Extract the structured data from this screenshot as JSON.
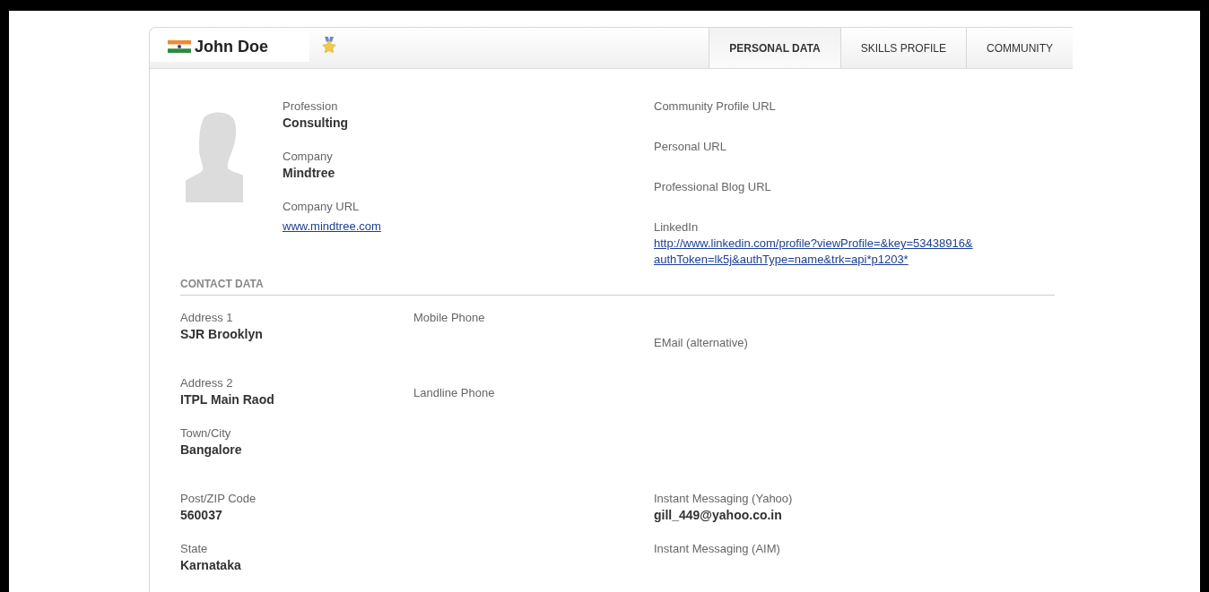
{
  "profile": {
    "name": "John Doe"
  },
  "tabs": [
    {
      "label": "PERSONAL DATA",
      "selected": true
    },
    {
      "label": "SKILLS PROFILE",
      "selected": false
    },
    {
      "label": "COMMUNITY",
      "selected": false
    }
  ],
  "work_fields": [
    {
      "label": "Profession",
      "value": "Consulting"
    },
    {
      "label": "Company",
      "value": "Mindtree"
    },
    {
      "label": "Company URL",
      "value": "www.mindtree.com",
      "kind": "link"
    }
  ],
  "web_fields": [
    {
      "label": "Community Profile URL"
    },
    {
      "label": "Personal URL"
    },
    {
      "label": "Professional Blog URL"
    },
    {
      "label": "LinkedIn",
      "value": "http://www.linkedin.com/profile?viewProfile=&key=53438916& authToken=lk5j&authType=name&trk=api*p1203*",
      "kind": "link"
    }
  ],
  "contact": {
    "title": "CONTACT DATA",
    "columns": [
      [
        {
          "label": "Address 1",
          "value": "SJR Brooklyn"
        },
        {
          "label": "Address 2",
          "value": "ITPL Main Raod"
        },
        {
          "label": "Town/City",
          "value": "Bangalore"
        },
        {
          "label": "Post/ZIP Code",
          "value": "560037"
        },
        {
          "label": "State",
          "value": "Karnataka"
        }
      ],
      [
        {
          "label": "Mobile Phone"
        },
        {
          "label": "Landline Phone"
        }
      ],
      [
        {
          "label": "EMail (alternative)"
        },
        {
          "label": "Instant Messaging (Yahoo)",
          "value": "gill_449@yahoo.co.in"
        },
        {
          "label": "Instant Messaging (AIM)"
        }
      ]
    ]
  }
}
